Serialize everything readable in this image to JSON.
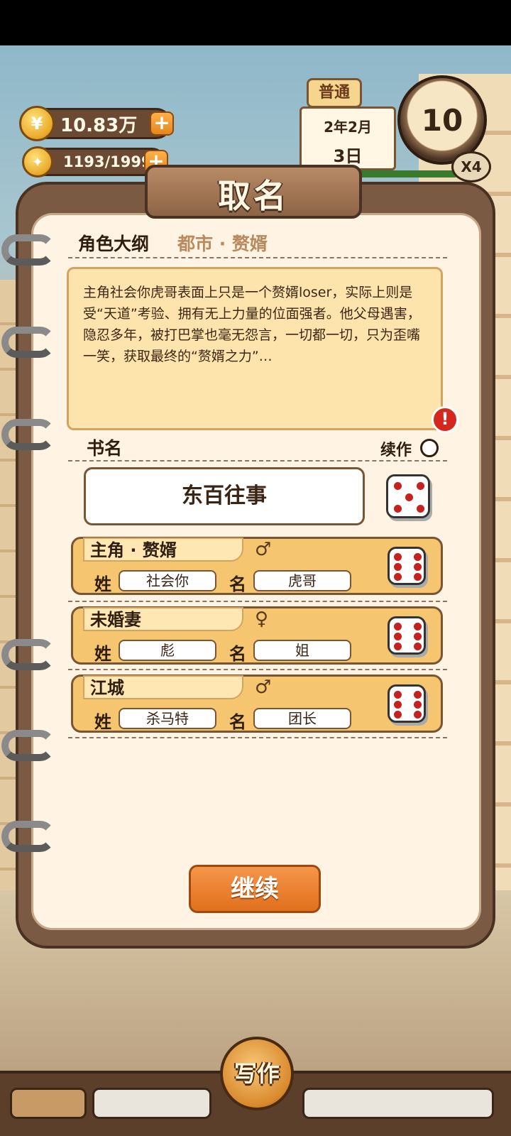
{
  "hud": {
    "coins": "10.83万",
    "energy": "1193/1999",
    "mode": "普通",
    "date_month": "2年2月",
    "date_day": "3日",
    "day_count": "10",
    "speed": "X4"
  },
  "dialog": {
    "title": "取名",
    "outline_label": "角色大纲",
    "genre": "都市 · 赘婿",
    "outline_text": "主角社会你虎哥表面上只是一个赘婿loser，实际上则是受“天道”考验、拥有无上力量的位面强者。他父母遇害，隐忍多年，被打巴掌也毫无怨言，一切都一切，只为歪嘴一笑，获取最终的“赘婿之力”…",
    "warning_icon": "!",
    "book_name_label": "书名",
    "sequel_label": "续作",
    "book_name": "东百往事",
    "surname_label": "姓",
    "given_label": "名",
    "characters": [
      {
        "role": "主角 · 赘婿",
        "gender": "♂",
        "surname": "社会你",
        "given": "虎哥"
      },
      {
        "role": "未婚妻",
        "gender": "♀",
        "surname": "彪",
        "given": "姐"
      },
      {
        "role": "江城",
        "gender": "♂",
        "surname": "杀马特",
        "given": "团长"
      }
    ],
    "continue_button": "继续"
  },
  "bottom_nav": {
    "write_button": "写作"
  },
  "colors": {
    "accent_orange": "#e0701d",
    "card_yellow": "#f6c570",
    "paper": "#fff3e3",
    "frame_brown": "#7b5a44"
  }
}
